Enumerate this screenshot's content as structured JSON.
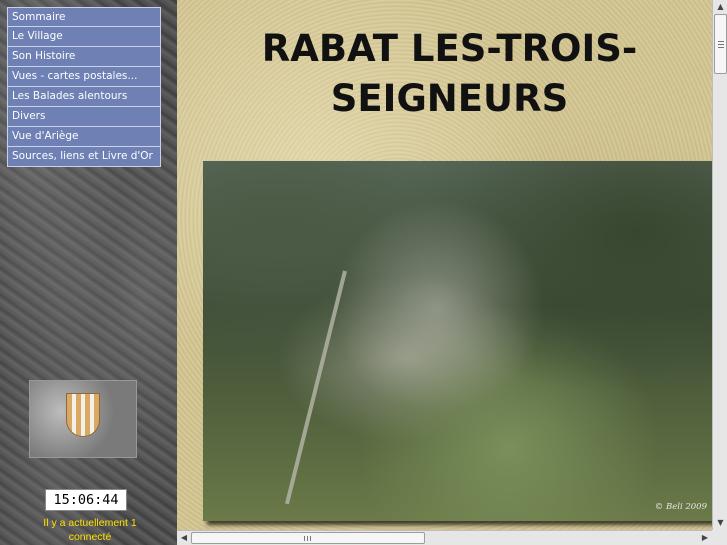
{
  "menu": {
    "items": [
      {
        "label": "Sommaire"
      },
      {
        "label": "Le Village"
      },
      {
        "label": "Son Histoire"
      },
      {
        "label": "Vues - cartes postales..."
      },
      {
        "label": "Les Balades alentours"
      },
      {
        "label": "Divers"
      },
      {
        "label": "Vue d'Ariège"
      },
      {
        "label": "Sources, liens et Livre d'Or"
      }
    ]
  },
  "clock": {
    "time": "15:06:44"
  },
  "online": {
    "line1": "Il y a actuellement 1",
    "line2": "connecté"
  },
  "main": {
    "title_line1": "RABAT LES-TROIS-",
    "title_line2": "SEIGNEURS",
    "photo_credit": "© Beli 2009"
  },
  "colors": {
    "menu_bg": "#6e80b4",
    "online_text": "#ffe000"
  },
  "icons": {
    "scroll_up": "▲",
    "scroll_down": "▼",
    "scroll_left": "◀",
    "scroll_right": "▶"
  }
}
